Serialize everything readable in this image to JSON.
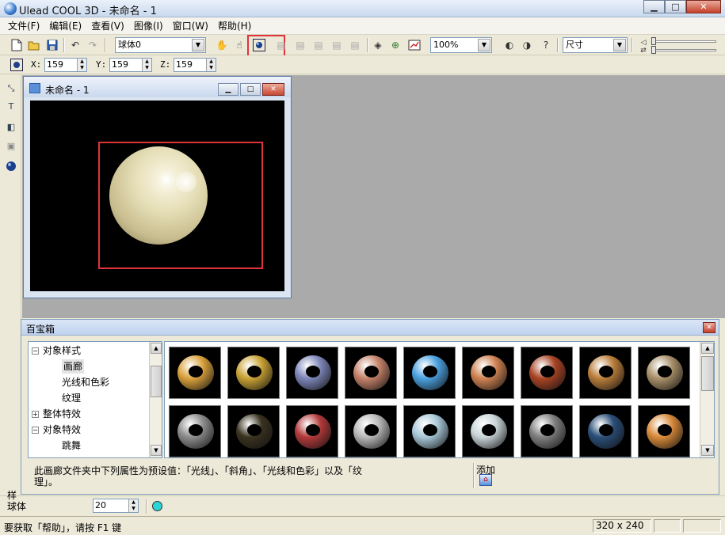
{
  "app": {
    "title": "Ulead COOL 3D - 未命名 - 1",
    "window_buttons": {
      "minimize": "▁",
      "maximize": "□",
      "close": "✕"
    }
  },
  "menu": [
    "文件(F)",
    "编辑(E)",
    "查看(V)",
    "图像(I)",
    "窗口(W)",
    "帮助(H)"
  ],
  "toolbar": {
    "object_select": "球体0",
    "zoom": "100%",
    "attribute_select": "尺寸",
    "highlight_color": "#e0333a"
  },
  "position": {
    "x_label": "X:",
    "x_value": "159",
    "y_label": "Y:",
    "y_value": "159",
    "z_label": "Z:",
    "z_value": "159"
  },
  "document": {
    "title": "未命名 - 1",
    "canvas_bg": "#000000",
    "object_color": "#e6dfb8"
  },
  "gallery": {
    "title": "百宝箱",
    "tree": [
      {
        "label": "对象样式",
        "expander": "−"
      },
      {
        "label": "画廊"
      },
      {
        "label": "光线和色彩"
      },
      {
        "label": "纹理"
      },
      {
        "label": "整体特效",
        "expander": "+"
      },
      {
        "label": "对象特效",
        "expander": "−"
      },
      {
        "label": "跳舞"
      }
    ],
    "thumbnails": [
      {
        "name": "gold",
        "color": "#d9a13c"
      },
      {
        "name": "gold-bright",
        "color": "#c9a235"
      },
      {
        "name": "chrome-blue",
        "color": "#7d86b8"
      },
      {
        "name": "copper-pink",
        "color": "#c5826a"
      },
      {
        "name": "blue-dotted",
        "color": "#4aa1e0"
      },
      {
        "name": "copper-dotted",
        "color": "#cf8252"
      },
      {
        "name": "red-copper",
        "color": "#a84424"
      },
      {
        "name": "bronze",
        "color": "#b97d3a"
      },
      {
        "name": "stone-dotted",
        "color": "#a89069"
      },
      {
        "name": "steel-holes",
        "color": "#8c8c8c"
      },
      {
        "name": "black-gold",
        "color": "#3a3220"
      },
      {
        "name": "patchwork",
        "color": "#b33a3a"
      },
      {
        "name": "silver-swirl",
        "color": "#b9b9b9"
      },
      {
        "name": "glass-blue",
        "color": "#a8c8d8"
      },
      {
        "name": "pearl-blue",
        "color": "#c8d4d8"
      },
      {
        "name": "steel-bolt",
        "color": "#7f7f7f"
      },
      {
        "name": "blue-stone",
        "color": "#2a4e78"
      },
      {
        "name": "orange-chrome",
        "color": "#d88a3a"
      }
    ],
    "description_1": "此画廊文件夹中下列属性为预设值：「光线」、「斜角」、「光线和色彩」以及「纹",
    "description_2": "理」。",
    "add_label": "添加"
  },
  "object_props": {
    "label": "球体",
    "hidden_label": "样",
    "value": "20",
    "color": "#29d5d5"
  },
  "status": {
    "help": "要获取「帮助」，请按 F1 键",
    "size": "320 x 240"
  }
}
